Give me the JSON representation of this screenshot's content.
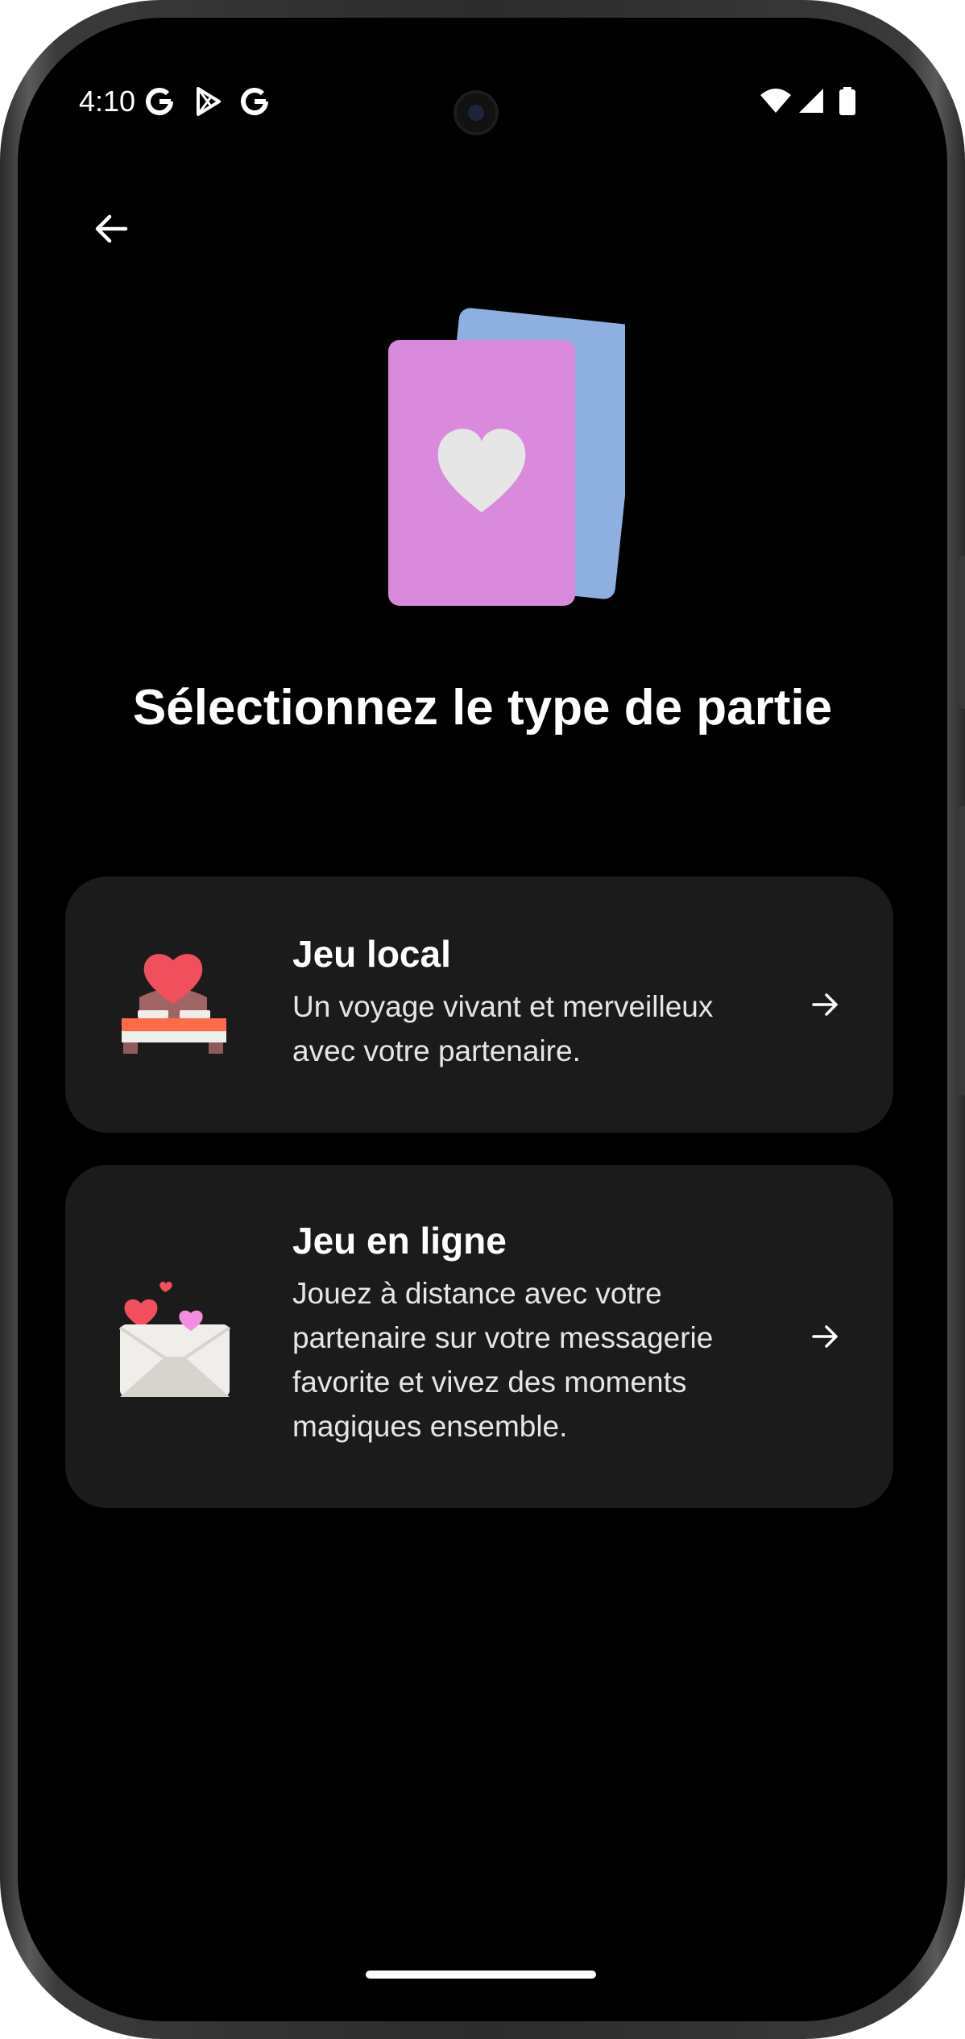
{
  "status_bar": {
    "time": "4:10",
    "icons": [
      "google-icon",
      "play-store-icon",
      "google-icon",
      "wifi-icon",
      "signal-icon",
      "battery-icon"
    ]
  },
  "header": {
    "back_icon": "arrow-left-icon"
  },
  "hero": {
    "icon": "cards-heart-icon",
    "colors": {
      "front_card": "#d98add",
      "back_card": "#8db0e0",
      "heart": "#e6e6e6"
    }
  },
  "main": {
    "title": "Sélectionnez le type de partie",
    "options": [
      {
        "title": "Jeu local",
        "description": "Un voyage vivant et merveilleux avec votre partenaire.",
        "icon": "bed-heart-icon",
        "arrow_icon": "arrow-right-icon"
      },
      {
        "title": "Jeu en ligne",
        "description": "Jouez à distance avec votre partenaire sur votre messagerie favorite et vivez des moments magiques ensemble.",
        "icon": "love-letter-icon",
        "arrow_icon": "arrow-right-icon"
      }
    ]
  },
  "theme": {
    "background": "#000000",
    "card_background": "#1b1b1b",
    "text": "#ffffff"
  }
}
